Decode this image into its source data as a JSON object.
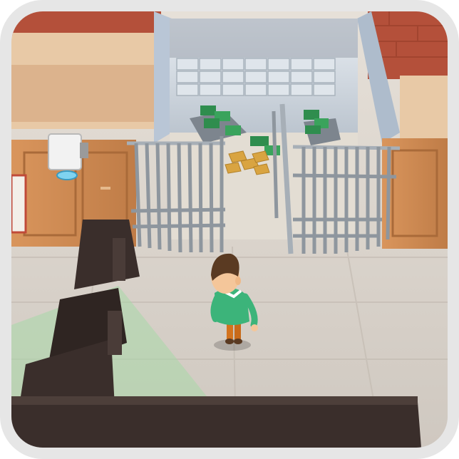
{
  "scene": {
    "type": "isometric-3d-game-view",
    "objects": [
      "bank-vault",
      "open-gate-left",
      "open-gate-right",
      "money-stack",
      "gold-bars",
      "security-camera",
      "player-character",
      "camera-vision-cone",
      "cabinet-desk",
      "front-counter"
    ],
    "colors": {
      "frame": "#e6e6e6",
      "floor": "#d8d2cc",
      "brick_wall": "#b4503a",
      "wood_wall": "#c98a55",
      "vault": "#c9d3df",
      "gate": "#8e969e",
      "money": "#2f8d4e",
      "gold": "#d9a441",
      "cone": "#a8d8a8",
      "player_shirt": "#3cb47a",
      "player_hair": "#5a3a22",
      "counter": "#3a2e2b"
    }
  }
}
